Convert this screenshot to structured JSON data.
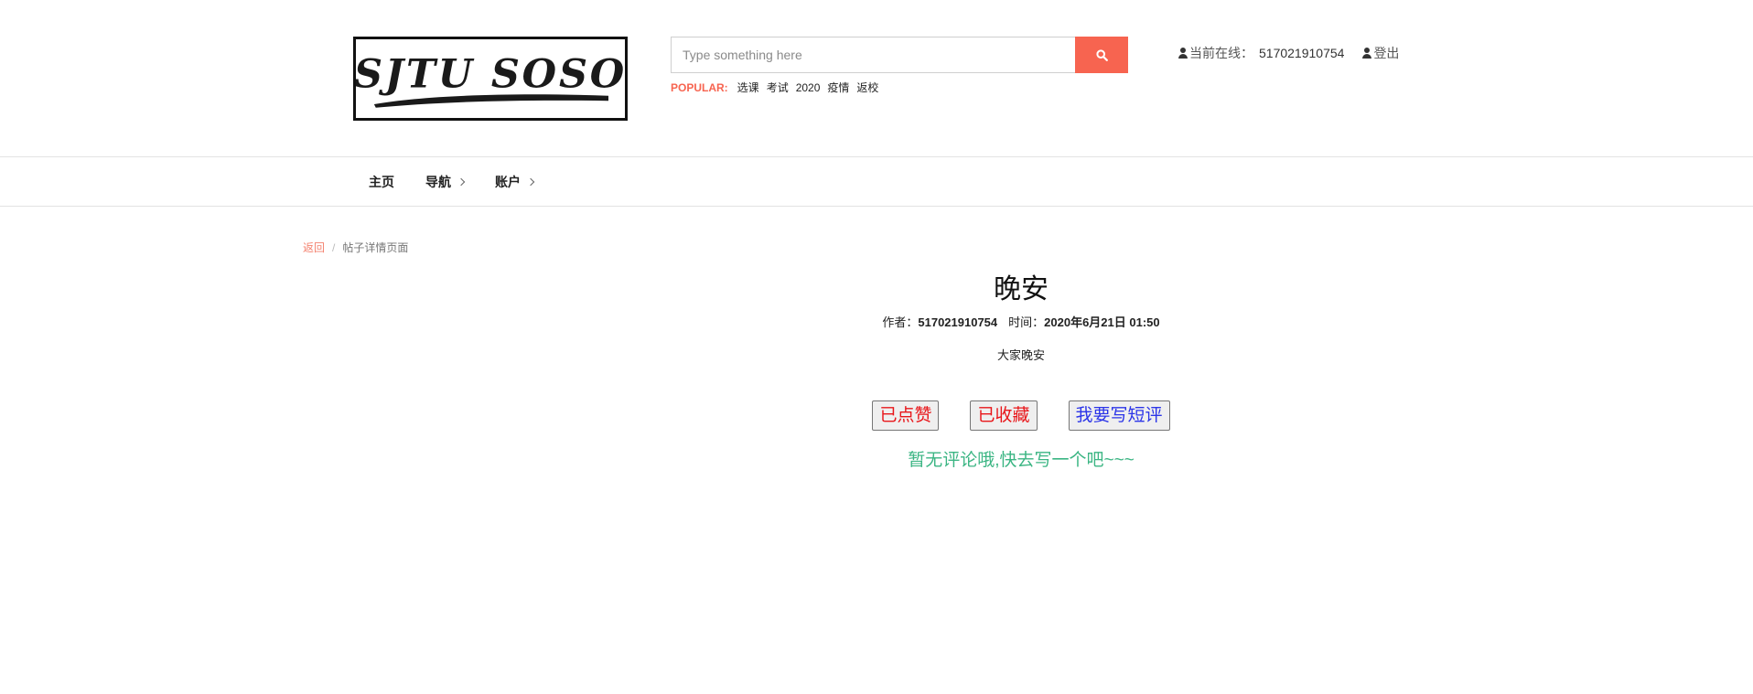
{
  "header": {
    "logo_text": "SJTU SOSO",
    "search": {
      "placeholder": "Type something here",
      "value": ""
    },
    "popular": {
      "label": "POPULAR:",
      "tags": [
        "选课",
        "考试",
        "2020",
        "疫情",
        "返校"
      ]
    },
    "user": {
      "online_label": "当前在线：",
      "user_id": "517021910754",
      "logout_label": "登出"
    }
  },
  "nav": {
    "items": [
      {
        "label": "主页",
        "has_submenu": false
      },
      {
        "label": "导航",
        "has_submenu": true
      },
      {
        "label": "账户",
        "has_submenu": true
      }
    ]
  },
  "breadcrumb": {
    "back_label": "返回",
    "separator": "/",
    "current": "帖子详情页面"
  },
  "post": {
    "title": "晚安",
    "author_label": "作者：",
    "author": "517021910754",
    "time_label": "时间：",
    "time": "2020年6月21日 01:50",
    "content": "大家晚安"
  },
  "actions": {
    "liked_label": "已点赞",
    "favorited_label": "已收藏",
    "write_review_label": "我要写短评"
  },
  "comments": {
    "empty_text": "暂无评论哦,快去写一个吧~~~"
  },
  "colors": {
    "accent": "#f76450",
    "liked_text": "#e8161a",
    "review_text": "#2b34e8",
    "empty_text": "#3bb583"
  }
}
